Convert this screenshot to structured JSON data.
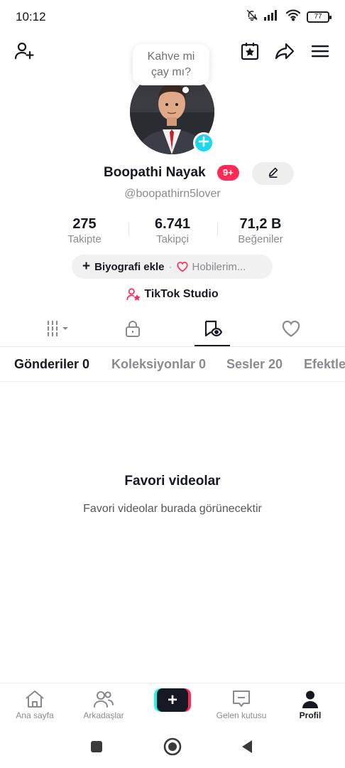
{
  "status_bar": {
    "time": "10:12",
    "battery": "77"
  },
  "bubble": {
    "text_line1": "Kahve mi",
    "text_line2": "çay mı?"
  },
  "profile": {
    "name": "Boopathi Nayak",
    "notification_badge": "9+",
    "username": "@boopathirn5lover"
  },
  "stats": [
    {
      "value": "275",
      "label": "Takipte"
    },
    {
      "value": "6.741",
      "label": "Takipçi"
    },
    {
      "value": "71,2 B",
      "label": "Beğeniler"
    }
  ],
  "bio": {
    "plus": "+",
    "add_label": "Biyografi ekle",
    "separator": "·",
    "hobbies_label": "Hobilerim..."
  },
  "studio": {
    "label": "TikTok Studio"
  },
  "sub_tabs": [
    {
      "label": "Gönderiler 0"
    },
    {
      "label": "Koleksiyonlar 0"
    },
    {
      "label": "Sesler 20"
    },
    {
      "label": "Efektler"
    }
  ],
  "empty_state": {
    "title": "Favori videolar",
    "text": "Favori videolar burada görünecektir"
  },
  "bottom_nav": [
    {
      "label": "Ana sayfa",
      "icon": "home-icon"
    },
    {
      "label": "Arkadaşlar",
      "icon": "friends-icon"
    },
    {
      "label": "+",
      "icon": "plus-icon"
    },
    {
      "label": "Gelen kutusu",
      "icon": "inbox-icon"
    },
    {
      "label": "Profil",
      "icon": "profile-icon"
    }
  ],
  "colors": {
    "accent_red": "#fe2c55",
    "accent_cyan": "#25f4ee",
    "avatar_add": "#20d5ec",
    "text_primary": "#161823",
    "text_secondary": "#8a8b91"
  }
}
